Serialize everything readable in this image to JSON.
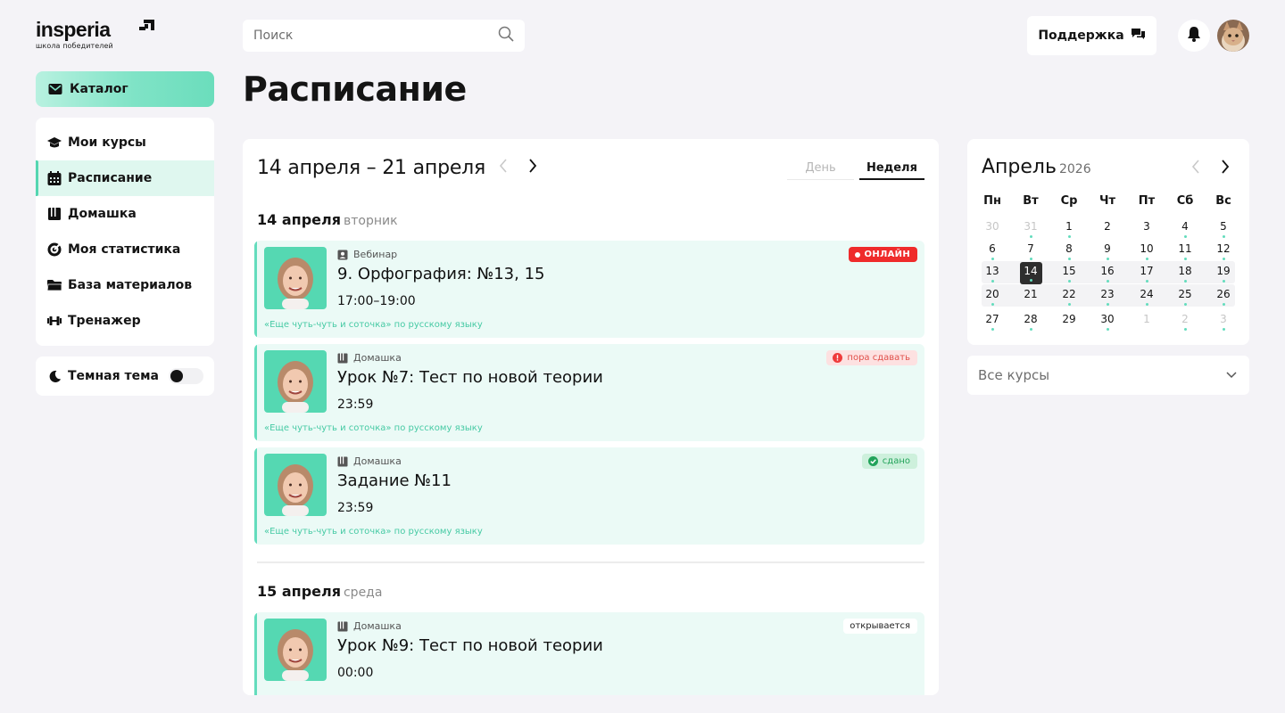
{
  "brand": {
    "name": "insperia",
    "tagline": "школа победителей"
  },
  "sidebar": {
    "catalog_label": "Каталог",
    "items": [
      {
        "label": "Мои курсы",
        "icon": "graduation-cap-icon",
        "active": false
      },
      {
        "label": "Расписание",
        "icon": "calendar-icon",
        "active": true
      },
      {
        "label": "Домашка",
        "icon": "book-icon",
        "active": false
      },
      {
        "label": "Моя статистика",
        "icon": "target-icon",
        "active": false
      },
      {
        "label": "База материалов",
        "icon": "folder-icon",
        "active": false
      },
      {
        "label": "Тренажер",
        "icon": "dumbbell-icon",
        "active": false
      }
    ],
    "theme_label": "Темная тема",
    "theme_enabled": false
  },
  "header": {
    "search_placeholder": "Поиск",
    "support_label": "Поддержка"
  },
  "page": {
    "title": "Расписание"
  },
  "schedule": {
    "range": "14 апреля – 21 апреля",
    "views": {
      "day": "День",
      "week": "Неделя",
      "selected": "Неделя"
    },
    "days": [
      {
        "date": "14 апреля",
        "weekday": "вторник",
        "events": [
          {
            "type": "Вебинар",
            "title": "9. Орфография: №13, 15",
            "time": "17:00–19:00",
            "course": "«Еще чуть-чуть и соточка» по русскому языку",
            "badge": "ОНЛАЙН",
            "badge_kind": "online"
          },
          {
            "type": "Домашка",
            "title": "Урок №7: Тест по новой теории",
            "time": "23:59",
            "course": "«Еще чуть-чуть и соточка» по русскому языку",
            "badge": "пора сдавать",
            "badge_kind": "due"
          },
          {
            "type": "Домашка",
            "title": "Задание №11",
            "time": "23:59",
            "course": "«Еще чуть-чуть и соточка» по русскому языку",
            "badge": "сдано",
            "badge_kind": "done"
          }
        ]
      },
      {
        "date": "15 апреля",
        "weekday": "среда",
        "events": [
          {
            "type": "Домашка",
            "title": "Урок №9: Тест по новой теории",
            "time": "00:00",
            "course": "",
            "badge": "открывается",
            "badge_kind": "opens"
          }
        ]
      }
    ]
  },
  "calendar": {
    "month": "Апрель",
    "year": "2026",
    "weekdays": [
      "Пн",
      "Вт",
      "Ср",
      "Чт",
      "Пт",
      "Сб",
      "Вс"
    ],
    "weeks": [
      [
        {
          "d": "30",
          "m": true,
          "dot": false
        },
        {
          "d": "31",
          "m": true,
          "dot": true
        },
        {
          "d": "1",
          "m": false,
          "dot": true
        },
        {
          "d": "2",
          "m": false,
          "dot": false
        },
        {
          "d": "3",
          "m": false,
          "dot": false
        },
        {
          "d": "4",
          "m": false,
          "dot": true
        },
        {
          "d": "5",
          "m": false,
          "dot": true
        }
      ],
      [
        {
          "d": "6",
          "m": false,
          "dot": true
        },
        {
          "d": "7",
          "m": false,
          "dot": true
        },
        {
          "d": "8",
          "m": false,
          "dot": true
        },
        {
          "d": "9",
          "m": false,
          "dot": true
        },
        {
          "d": "10",
          "m": false,
          "dot": true
        },
        {
          "d": "11",
          "m": false,
          "dot": true
        },
        {
          "d": "12",
          "m": false,
          "dot": true
        }
      ],
      [
        {
          "d": "13",
          "m": false,
          "dot": true
        },
        {
          "d": "14",
          "m": false,
          "dot": true,
          "today": true
        },
        {
          "d": "15",
          "m": false,
          "dot": true
        },
        {
          "d": "16",
          "m": false,
          "dot": true
        },
        {
          "d": "17",
          "m": false,
          "dot": true
        },
        {
          "d": "18",
          "m": false,
          "dot": true
        },
        {
          "d": "19",
          "m": false,
          "dot": true
        }
      ],
      [
        {
          "d": "20",
          "m": false,
          "dot": true
        },
        {
          "d": "21",
          "m": false,
          "dot": false
        },
        {
          "d": "22",
          "m": false,
          "dot": true
        },
        {
          "d": "23",
          "m": false,
          "dot": true
        },
        {
          "d": "24",
          "m": false,
          "dot": true
        },
        {
          "d": "25",
          "m": false,
          "dot": true
        },
        {
          "d": "26",
          "m": false,
          "dot": true
        }
      ],
      [
        {
          "d": "27",
          "m": false,
          "dot": true
        },
        {
          "d": "28",
          "m": false,
          "dot": true
        },
        {
          "d": "29",
          "m": false,
          "dot": false
        },
        {
          "d": "30",
          "m": false,
          "dot": true
        },
        {
          "d": "1",
          "m": true,
          "dot": false
        },
        {
          "d": "2",
          "m": true,
          "dot": true
        },
        {
          "d": "3",
          "m": true,
          "dot": true
        }
      ]
    ],
    "highlighted_week_rows": [
      2,
      3
    ]
  },
  "filter": {
    "course_select": "Все курсы"
  },
  "colors": {
    "accent": "#63dcbd",
    "online": "#ef2b2b",
    "event_bg": "#ebfaf6",
    "page_bg": "#f4f3f7"
  }
}
